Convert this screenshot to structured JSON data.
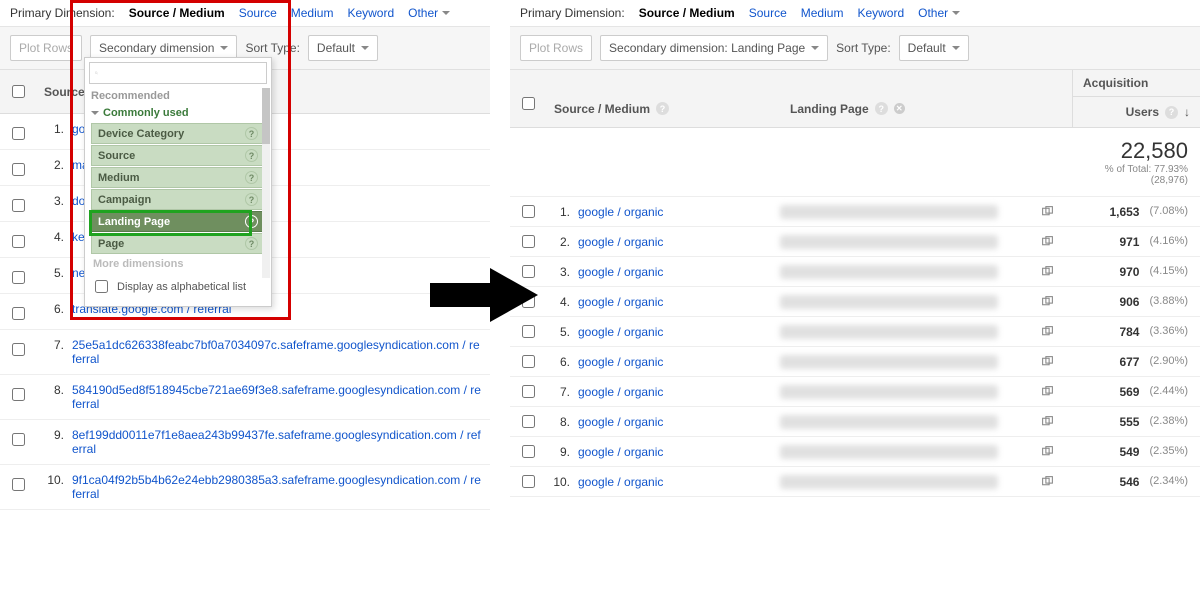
{
  "primary": {
    "label": "Primary Dimension:",
    "active": "Source / Medium",
    "links": [
      "Source",
      "Medium",
      "Keyword"
    ],
    "other": "Other"
  },
  "controls": {
    "plot_rows": "Plot Rows",
    "secondary_left": "Secondary dimension",
    "secondary_right": "Secondary dimension: Landing Page",
    "sort_label": "Sort Type:",
    "sort_default": "Default"
  },
  "dropdown": {
    "recommended": "Recommended",
    "group": "Commonly used",
    "items": [
      "Device Category",
      "Source",
      "Medium",
      "Campaign",
      "Landing Page",
      "Page"
    ],
    "more": "More dimensions",
    "alpha": "Display as alphabetical list"
  },
  "left_table": {
    "header": "Source / Medium",
    "rows": [
      {
        "n": "1.",
        "txt": "google / organic"
      },
      {
        "n": "2.",
        "txt": "mail.google.com / referral"
      },
      {
        "n": "3.",
        "txt": "docs.google.com / referral"
      },
      {
        "n": "4.",
        "txt": "keep.google.com / referral"
      },
      {
        "n": "5.",
        "txt": "news.google.com / referral"
      },
      {
        "n": "6.",
        "txt": "translate.google.com / referral"
      },
      {
        "n": "7.",
        "txt": "25e5a1dc626338feabc7bf0a7034097c.safeframe.googlesyndication.com / referral"
      },
      {
        "n": "8.",
        "txt": "584190d5ed8f518945cbe721ae69f3e8.safeframe.googlesyndication.com / referral"
      },
      {
        "n": "9.",
        "txt": "8ef199dd0011e7f1e8aea243b99437fe.safeframe.googlesyndication.com / referral"
      },
      {
        "n": "10.",
        "txt": "9f1ca04f92b5b4b62e24ebb2980385a3.safeframe.googlesyndication.com / referral"
      }
    ]
  },
  "right_table": {
    "h_source": "Source / Medium",
    "h_landing": "Landing Page",
    "h_acq": "Acquisition",
    "h_users": "Users",
    "totals": {
      "value": "22,580",
      "sub1": "% of Total: 77.93%",
      "sub2": "(28,976)"
    },
    "rows": [
      {
        "n": "1.",
        "sm": "google / organic",
        "users": "1,653",
        "pct": "(7.08%)"
      },
      {
        "n": "2.",
        "sm": "google / organic",
        "users": "971",
        "pct": "(4.16%)"
      },
      {
        "n": "3.",
        "sm": "google / organic",
        "users": "970",
        "pct": "(4.15%)"
      },
      {
        "n": "4.",
        "sm": "google / organic",
        "users": "906",
        "pct": "(3.88%)"
      },
      {
        "n": "5.",
        "sm": "google / organic",
        "users": "784",
        "pct": "(3.36%)"
      },
      {
        "n": "6.",
        "sm": "google / organic",
        "users": "677",
        "pct": "(2.90%)"
      },
      {
        "n": "7.",
        "sm": "google / organic",
        "users": "569",
        "pct": "(2.44%)"
      },
      {
        "n": "8.",
        "sm": "google / organic",
        "users": "555",
        "pct": "(2.38%)"
      },
      {
        "n": "9.",
        "sm": "google / organic",
        "users": "549",
        "pct": "(2.35%)"
      },
      {
        "n": "10.",
        "sm": "google / organic",
        "users": "546",
        "pct": "(2.34%)"
      }
    ]
  }
}
